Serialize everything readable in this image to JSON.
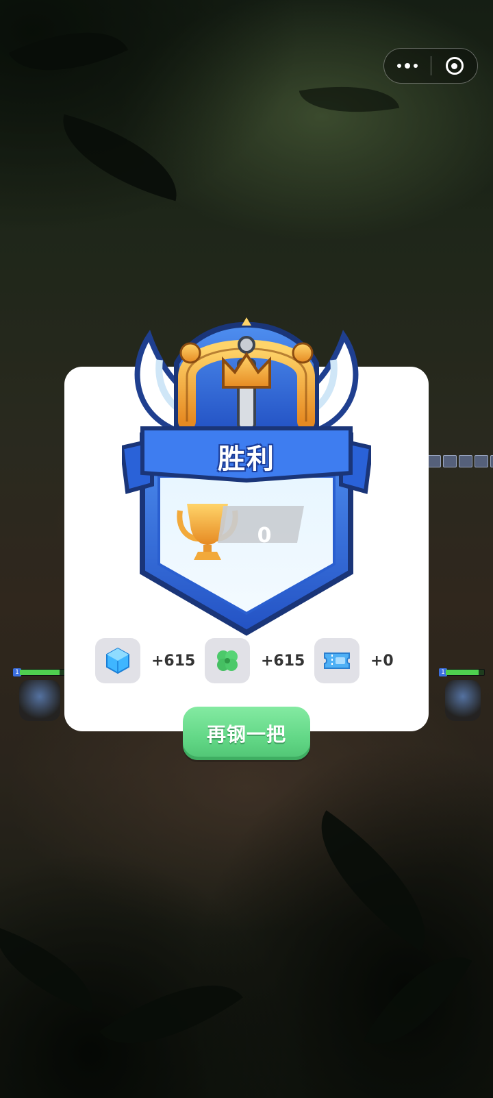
{
  "result": {
    "title": "胜利",
    "trophy_score": "0"
  },
  "rewards": [
    {
      "icon": "blue-gem-icon",
      "amount": "+615"
    },
    {
      "icon": "four-leaf-clover-icon",
      "amount": "+615"
    },
    {
      "icon": "ticket-icon",
      "amount": "+0"
    }
  ],
  "actions": {
    "play_again_label": "再钢一把"
  },
  "colors": {
    "card_background": "#ffffff",
    "button_green": "#62d786",
    "shield_blue": "#2f6fe0",
    "gold": "#f2a93a"
  }
}
